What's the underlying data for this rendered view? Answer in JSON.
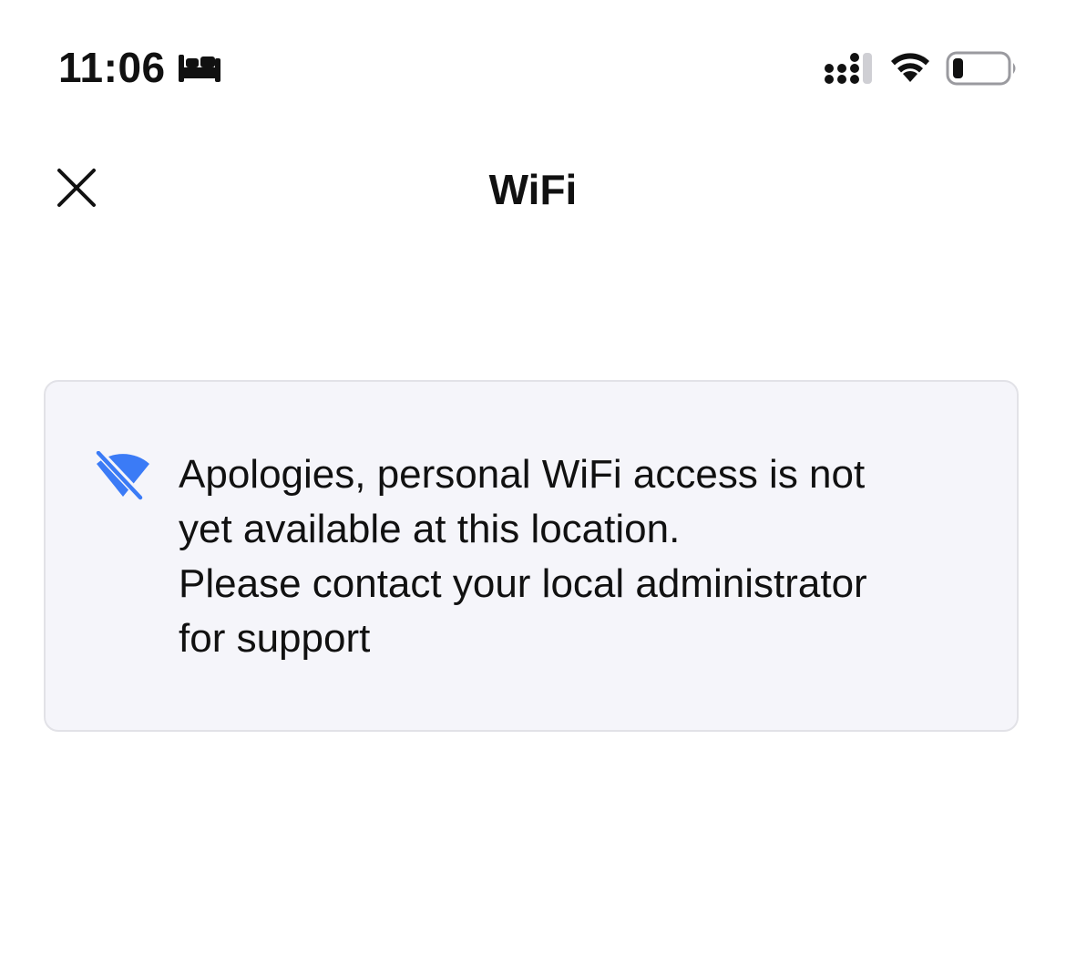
{
  "status_bar": {
    "time": "11:06",
    "bed_icon": "bed-icon",
    "signal_icon": "cellular-signal-icon",
    "wifi_icon": "wifi-icon",
    "battery_icon": "battery-low-icon",
    "battery_level_percent": 15
  },
  "header": {
    "title": "WiFi",
    "close_icon": "close-icon"
  },
  "notice": {
    "icon": "wifi-off-icon",
    "icon_color": "#3b7bf6",
    "lines": [
      "Apologies, personal WiFi access is not",
      "yet available at this location.",
      "Please contact your local administrator",
      "for support"
    ]
  },
  "colors": {
    "accent": "#3b7bf6",
    "card_background": "#f5f5fa",
    "card_border": "#e2e2e7"
  }
}
